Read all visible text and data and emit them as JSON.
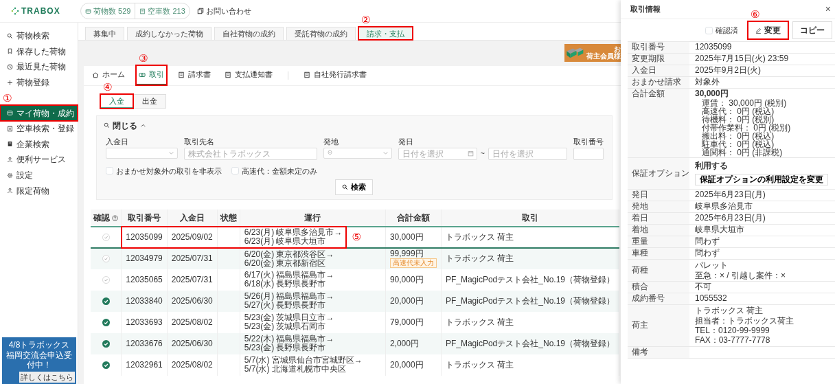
{
  "header": {
    "logo": "TRABOX",
    "stats": [
      {
        "label": "荷物数 529"
      },
      {
        "label": "空車数 213"
      }
    ],
    "contact": "お問い合わせ"
  },
  "sidebar": {
    "items": [
      {
        "label": "荷物検索",
        "selected": false
      },
      {
        "label": "保存した荷物",
        "selected": false
      },
      {
        "label": "最近見た荷物",
        "selected": false
      },
      {
        "label": "荷物登録",
        "selected": false
      },
      {
        "label": "マイ荷物・成約",
        "selected": true,
        "annotation": "①"
      },
      {
        "label": "空車検索・登録",
        "selected": false
      },
      {
        "label": "企業検索",
        "selected": false
      },
      {
        "label": "便利サービス",
        "selected": false
      },
      {
        "label": "設定",
        "selected": false
      },
      {
        "label": "限定荷物",
        "selected": false
      }
    ],
    "banner": {
      "lines": [
        "4/8トラボックス",
        "福岡交流会申込受付中！"
      ],
      "link": "詳しくはこちら"
    }
  },
  "tabs": [
    {
      "label": "募集中",
      "selected": false
    },
    {
      "label": "成約しなかった荷物",
      "selected": false
    },
    {
      "label": "自社荷物の成約",
      "selected": false
    },
    {
      "label": "受託荷物の成約",
      "selected": false
    },
    {
      "label": "請求・支払",
      "selected": true,
      "annotation": "②"
    }
  ],
  "ad_banner": {
    "lines": [
      "お",
      "荷主会員様"
    ]
  },
  "subtab_groups": [
    [
      {
        "label": "ホーム",
        "selected": false
      },
      {
        "label": "取引",
        "selected": true,
        "annotation": "③"
      },
      {
        "label": "請求書",
        "selected": false
      },
      {
        "label": "支払通知書",
        "selected": false
      }
    ],
    [
      {
        "label": "自社発行請求書",
        "selected": false
      }
    ]
  ],
  "payment_toggle": [
    {
      "label": "入金",
      "selected": true,
      "annotation": "④"
    },
    {
      "label": "出金",
      "selected": false
    }
  ],
  "filter": {
    "toggle_label": "閉じる",
    "expanded": true,
    "fields": [
      {
        "label": "入金日",
        "kind": "select"
      },
      {
        "label": "取引先名",
        "kind": "text",
        "placeholder": "株式会社トラボックス"
      },
      {
        "label": "発地",
        "kind": "location"
      },
      {
        "label": "発日",
        "kind": "daterange",
        "placeholders": [
          "日付を選択",
          "日付を選択"
        ],
        "separator": "~"
      },
      {
        "label": "取引番号",
        "kind": "text"
      }
    ],
    "checkboxes": [
      {
        "label": "おまかせ対象外の取引を非表示",
        "checked": false
      },
      {
        "label": "高速代：金額未定のみ",
        "checked": false
      }
    ],
    "search_button": "検索"
  },
  "table": {
    "columns": [
      {
        "label": "確認",
        "help": true
      },
      {
        "label": "取引番号",
        "help": false
      },
      {
        "label": "入金日",
        "help": false
      },
      {
        "label": "状態",
        "help": false
      },
      {
        "label": "運行",
        "help": false
      },
      {
        "label": "合計金額",
        "help": false
      },
      {
        "label": "取引",
        "help": false
      }
    ],
    "rows": [
      {
        "confirmed": false,
        "selected": true,
        "id": "12035099",
        "date": "2025/09/02",
        "route": [
          "6/23(月) 岐阜県多治見市→",
          "6/23(月) 岐阜県大垣市"
        ],
        "total": "30,000円",
        "partner": "トラボックス 荷主",
        "annotation": "⑤"
      },
      {
        "confirmed": false,
        "selected": false,
        "id": "12034979",
        "date": "2025/07/31",
        "route": [
          "6/20(金) 東京都渋谷区→",
          "6/20(金) 東京都新宿区"
        ],
        "total": "99,999円",
        "tag": "高速代未入力",
        "partner": "トラボックス 荷主"
      },
      {
        "confirmed": false,
        "selected": false,
        "id": "12035065",
        "date": "2025/07/31",
        "route": [
          "6/17(火) 福島県福島市→",
          "6/18(水) 長野県長野市"
        ],
        "total": "90,000円",
        "partner": "PF_MagicPodテスト会社_No.19（荷物登録）"
      },
      {
        "confirmed": true,
        "selected": false,
        "id": "12033840",
        "date": "2025/06/30",
        "route": [
          "5/26(月) 福島県福島市→",
          "5/27(火) 長野県長野市"
        ],
        "total": "20,000円",
        "partner": "PF_MagicPodテスト会社_No.19（荷物登録）"
      },
      {
        "confirmed": true,
        "selected": false,
        "id": "12033693",
        "date": "2025/08/02",
        "route": [
          "5/23(金) 茨城県日立市→",
          "5/23(金) 茨城県石岡市"
        ],
        "total": "79,000円",
        "partner": "トラボックス 荷主"
      },
      {
        "confirmed": true,
        "selected": false,
        "id": "12033676",
        "date": "2025/06/30",
        "route": [
          "5/22(木) 福島県福島市→",
          "5/23(金) 長野県長野市"
        ],
        "total": "2,000円",
        "partner": "PF_MagicPodテスト会社_No.19（荷物登録）"
      },
      {
        "confirmed": true,
        "selected": false,
        "id": "12032961",
        "date": "2025/08/02",
        "route": [
          "5/7(水) 宮城県仙台市宮城野区→",
          "5/7(水) 北海道札幌市中央区"
        ],
        "total": "20,000円",
        "partner": "トラボックス 荷主"
      }
    ]
  },
  "panel": {
    "title": "取引情報",
    "close": "×",
    "confirm_checkbox": {
      "label": "確認済",
      "checked": false
    },
    "buttons": [
      {
        "label": "変更",
        "kind": "edit",
        "annotation": "⑥"
      },
      {
        "label": "コピー",
        "kind": "plain"
      }
    ],
    "details": [
      {
        "label": "取引番号",
        "kind": "text",
        "lines": [
          "12035099"
        ]
      },
      {
        "label": "変更期限",
        "kind": "text",
        "lines": [
          "2025年7月15日(火) 23:59"
        ]
      },
      {
        "label": "入金日",
        "kind": "text",
        "lines": [
          "2025年9月2日(火)"
        ]
      },
      {
        "label": "おまかせ請求",
        "kind": "text",
        "lines": [
          "対象外"
        ]
      },
      {
        "label": "合計金額",
        "kind": "total",
        "lines": [
          "30,000円",
          "運賃： 30,000円 (税別)",
          "高速代： 0円 (税込)",
          "待機料： 0円 (税別)",
          "付帯作業料： 0円 (税別)",
          "搬出料： 0円 (税込)",
          "駐車代： 0円 (税込)",
          "通関料： 0円 (非課税)"
        ]
      },
      {
        "label": "保証オプション",
        "kind": "option",
        "lines": [
          "利用する"
        ],
        "button": "保証オプションの利用設定を変更"
      },
      {
        "label": "発日",
        "kind": "text",
        "lines": [
          "2025年6月23日(月)"
        ]
      },
      {
        "label": "発地",
        "kind": "text",
        "lines": [
          "岐阜県多治見市"
        ]
      },
      {
        "label": "着日",
        "kind": "text",
        "lines": [
          "2025年6月23日(月)"
        ]
      },
      {
        "label": "着地",
        "kind": "text",
        "lines": [
          "岐阜県大垣市"
        ]
      },
      {
        "label": "重量",
        "kind": "text",
        "lines": [
          "問わず"
        ]
      },
      {
        "label": "車種",
        "kind": "text",
        "lines": [
          "問わず"
        ]
      },
      {
        "label": "荷種",
        "kind": "text",
        "lines": [
          "パレット",
          "至急：× / 引越し案件：×"
        ]
      },
      {
        "label": "積合",
        "kind": "text",
        "lines": [
          "不可"
        ]
      },
      {
        "label": "成約番号",
        "kind": "text",
        "lines": [
          "1055532"
        ]
      },
      {
        "label": "荷主",
        "kind": "text",
        "lines": [
          "トラボックス 荷主",
          "担当者：トラボックス荷主",
          "TEL：0120-99-9999",
          "FAX：03-7777-7778"
        ]
      },
      {
        "label": "備考",
        "kind": "text"
      }
    ]
  }
}
